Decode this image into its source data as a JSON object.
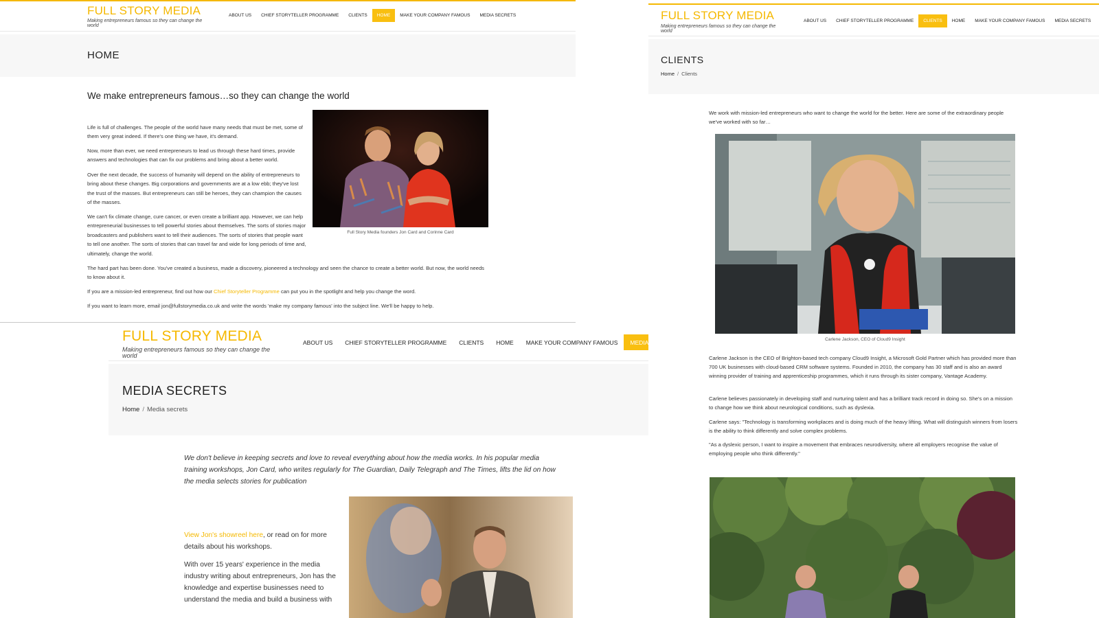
{
  "brand": {
    "title": "FULL STORY MEDIA",
    "tagline": "Making entrepreneurs famous so they can change the world"
  },
  "colors": {
    "accent": "#f9bf10",
    "link": "#f5b800",
    "title_bar": "#f7f7f7"
  },
  "home_page": {
    "nav": [
      "ABOUT US",
      "CHIEF STORYTELLER PROGRAMME",
      "CLIENTS",
      "HOME",
      "MAKE YOUR COMPANY FAMOUS",
      "MEDIA SECRETS"
    ],
    "active_nav": "HOME",
    "page_title": "HOME",
    "heading": "We make entrepreneurs famous…so they can change the world",
    "paragraphs": [
      "Life is full of challenges. The people of the world have many needs that must be met, some of them very great indeed. If there's one thing we have, it's demand.",
      "Now, more than ever, we need entrepreneurs to lead us through these hard times, provide answers and technologies that can fix our problems and bring about a better world.",
      "Over the next decade, the success of humanity will depend on the ability of entrepreneurs to bring about these changes. Big corporations and governments are at a low ebb; they've lost the trust of the masses. But entrepreneurs can still be heroes, they can champion the causes of the masses.",
      "We can't fix climate change, cure cancer, or even create a brilliant app. However, we can help entrepreneurial businesses to tell powerful stories about themselves. The sorts of stories major broadcasters and publishers want to tell their audiences. The sorts of stories that people want to tell one another. The sorts of stories that can travel far and wide for long periods of time and, ultimately, change the world.",
      "The hard part has been done. You've created a business, made a discovery, pioneered a technology and seen the chance to create a better world. But now, the world needs to know about it."
    ],
    "cta_prefix": "If you are a mission-led entrepreneur, find out how our ",
    "cta_link": "Chief Storyteller Programme",
    "cta_suffix": " can put you in the spotlight and help you change the word.",
    "contact_text": "If you want to learn more, email jon@fullstorymedia.co.uk and write the words 'make my company famous' into the subject line. We'll be happy to help.",
    "photo_caption": "Full Story Media founders Jon Card and Corinne Card"
  },
  "clients_page": {
    "nav": [
      "ABOUT US",
      "CHIEF STORYTELLER PROGRAMME",
      "CLIENTS",
      "HOME",
      "MAKE YOUR COMPANY FAMOUS",
      "MEDIA SECRETS"
    ],
    "active_nav": "CLIENTS",
    "page_title": "CLIENTS",
    "breadcrumb_home": "Home",
    "breadcrumb_current": "Clients",
    "intro": "We work with mission-led entrepreneurs who want to change the world for the better. Here are some of the extraordinary people we've worked with so far…",
    "photo_caption": "Carlene Jackson, CEO of Cloud9 Insight",
    "paragraphs": [
      "Carlene Jackson is the CEO of Brighton-based tech company Cloud9 Insight, a Microsoft Gold Partner which has provided more than 700 UK businesses with cloud-based CRM software systems. Founded in 2010, the company has 30 staff and is also an award winning provider of training and apprenticeship programmes, which it runs through its sister company, Vantage Academy.",
      "Carlene believes passionately in developing staff and nurturing talent and has a brilliant track record in doing so. She's on a mission to change how we think about neurological conditions, such as dyslexia.",
      "Carlene says: \"Technology is transforming workplaces and is doing much of the heavy lifting. What will distinguish winners from losers is the ability to think differently and solve complex problems.",
      "\"As a dyslexic person, I want to inspire a movement that embraces neurodiversity, where all employers recognise the value of employing people who think differently.\""
    ]
  },
  "media_page": {
    "nav": [
      "ABOUT US",
      "CHIEF STORYTELLER PROGRAMME",
      "CLIENTS",
      "HOME",
      "MAKE YOUR COMPANY FAMOUS",
      "MEDIA SECRETS"
    ],
    "active_nav": "MEDIA SECRETS",
    "page_title": "MEDIA SECRETS",
    "breadcrumb_home": "Home",
    "breadcrumb_current": "Media secrets",
    "intro": "We don't believe in keeping secrets and love to reveal everything about how the media works. In his popular media training workshops, Jon Card, who writes regularly for The Guardian, Daily Telegraph and The Times, lifts the lid on how the media selects stories for publication",
    "showreel_link": "View Jon's showreel here",
    "showreel_suffix": ", or read on for more details about his workshops.",
    "body": "With over 15 years' experience in the media industry writing about entrepreneurs, Jon has the knowledge and expertise businesses need to understand the media and build a business with"
  }
}
